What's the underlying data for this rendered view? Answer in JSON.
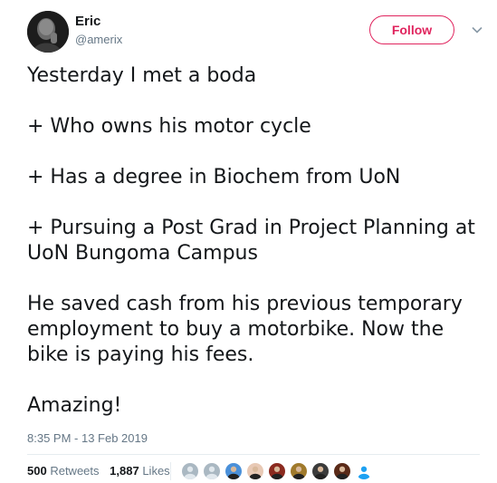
{
  "user": {
    "name": "Eric",
    "handle": "@amerix"
  },
  "follow_label": "Follow",
  "tweet": {
    "lines": [
      "Yesterday I met a boda",
      "+ Who owns his motor cycle",
      "+ Has a degree in Biochem from UoN",
      "+ Pursuing a Post Grad in Project Planning at UoN Bungoma Campus",
      "He saved cash from his previous temporary employment to buy a motorbike. Now the bike is paying his fees.",
      "Amazing!"
    ]
  },
  "timestamp": "8:35 PM - 13 Feb 2019",
  "stats": {
    "retweets_count": "500",
    "retweets_label": "Retweets",
    "likes_count": "1,887",
    "likes_label": "Likes"
  },
  "likers": [
    {
      "icon": "default-avatar-icon",
      "color": "#aab8c2"
    },
    {
      "icon": "default-avatar-icon",
      "color": "#aab8c2"
    },
    {
      "icon": "avatar-blue-icon",
      "color": "#4a90d9"
    },
    {
      "icon": "avatar-pattern-icon",
      "color": "#e8c9b5"
    },
    {
      "icon": "avatar-red-icon",
      "color": "#8b2a1f"
    },
    {
      "icon": "avatar-gold-icon",
      "color": "#a07a2c"
    },
    {
      "icon": "avatar-photo-icon",
      "color": "#3b3b3b"
    },
    {
      "icon": "avatar-photo-icon",
      "color": "#5a2a18"
    },
    {
      "icon": "avatar-figure-icon",
      "color": "#1da1f2"
    }
  ],
  "colors": {
    "accent": "#e0245e",
    "secondary_text": "#657786",
    "primary_text": "#14171a"
  }
}
